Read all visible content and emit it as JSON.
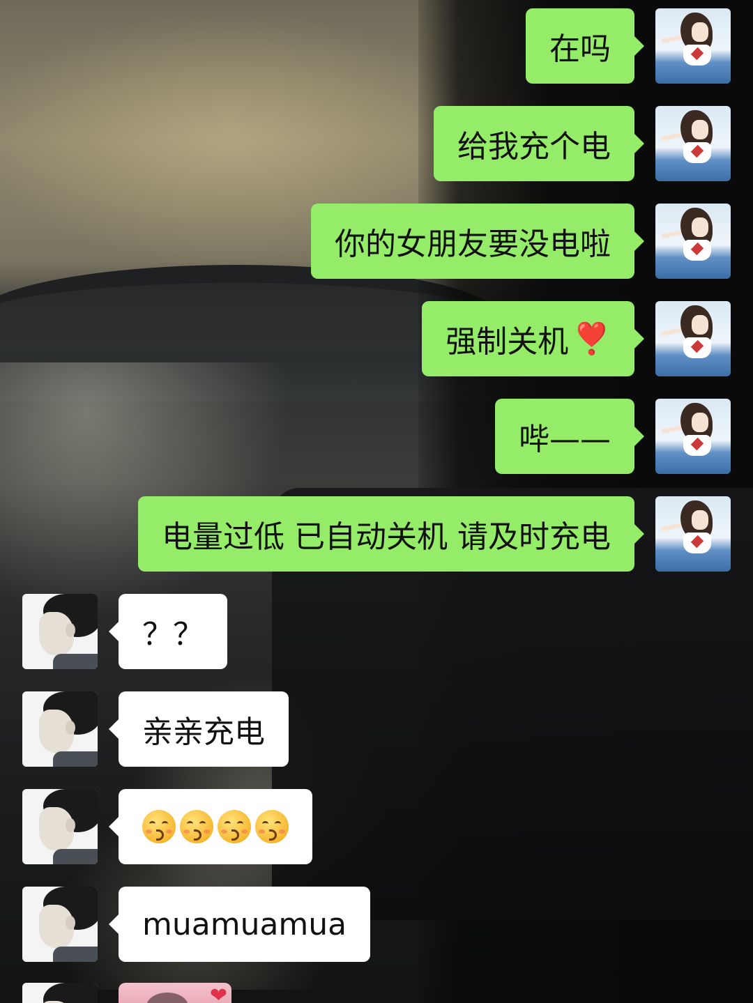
{
  "messages": [
    {
      "side": "right",
      "text": "在吗"
    },
    {
      "side": "right",
      "text": "给我充个电"
    },
    {
      "side": "right",
      "text": "你的女朋友要没电啦"
    },
    {
      "side": "right",
      "text": "强制关机",
      "emoji": "❣️"
    },
    {
      "side": "right",
      "text": "哔——"
    },
    {
      "side": "right",
      "text": "电量过低 已自动关机 请及时充电"
    },
    {
      "side": "left",
      "text": "？？"
    },
    {
      "side": "left",
      "text": "亲亲充电"
    },
    {
      "side": "left",
      "emoji_icon": "kissing-face-icon",
      "emoji_count": 4
    },
    {
      "side": "left",
      "text": "muamuamua"
    },
    {
      "side": "left",
      "sticker_icon": "heart-sticker-icon"
    }
  ],
  "avatars": {
    "self": "anime-girl-avatar",
    "other": "boy-profile-avatar"
  },
  "colors": {
    "sent_bubble": "#95ec69",
    "received_bubble": "#ffffff"
  }
}
